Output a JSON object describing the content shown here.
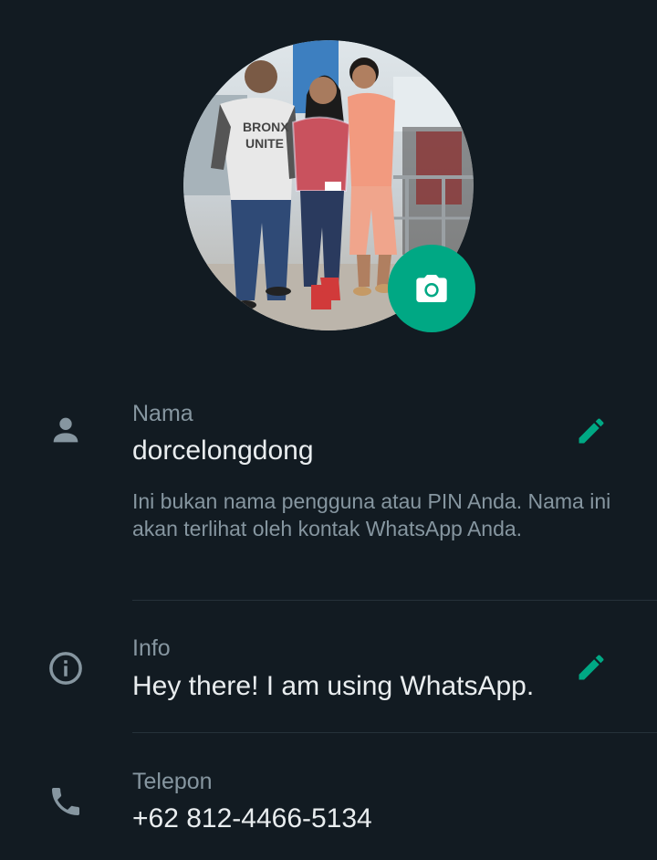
{
  "profile": {
    "photo_alt": "Profile photo",
    "camera_icon": "camera-icon"
  },
  "name": {
    "label": "Nama",
    "value": "dorcelongdong",
    "hint": "Ini bukan nama pengguna atau PIN Anda. Nama ini akan terlihat oleh kontak WhatsApp Anda.",
    "icon": "person-icon",
    "edit_icon": "pencil-icon"
  },
  "about": {
    "label": "Info",
    "value": "Hey there! I am using WhatsApp.",
    "icon": "info-icon",
    "edit_icon": "pencil-icon"
  },
  "phone": {
    "label": "Telepon",
    "value": "+62 812-4466-5134",
    "icon": "phone-icon"
  },
  "colors": {
    "background": "#121b22",
    "accent": "#00a884",
    "primary_text": "#e9edef",
    "secondary_text": "#8696a0",
    "divider": "#26323a"
  }
}
